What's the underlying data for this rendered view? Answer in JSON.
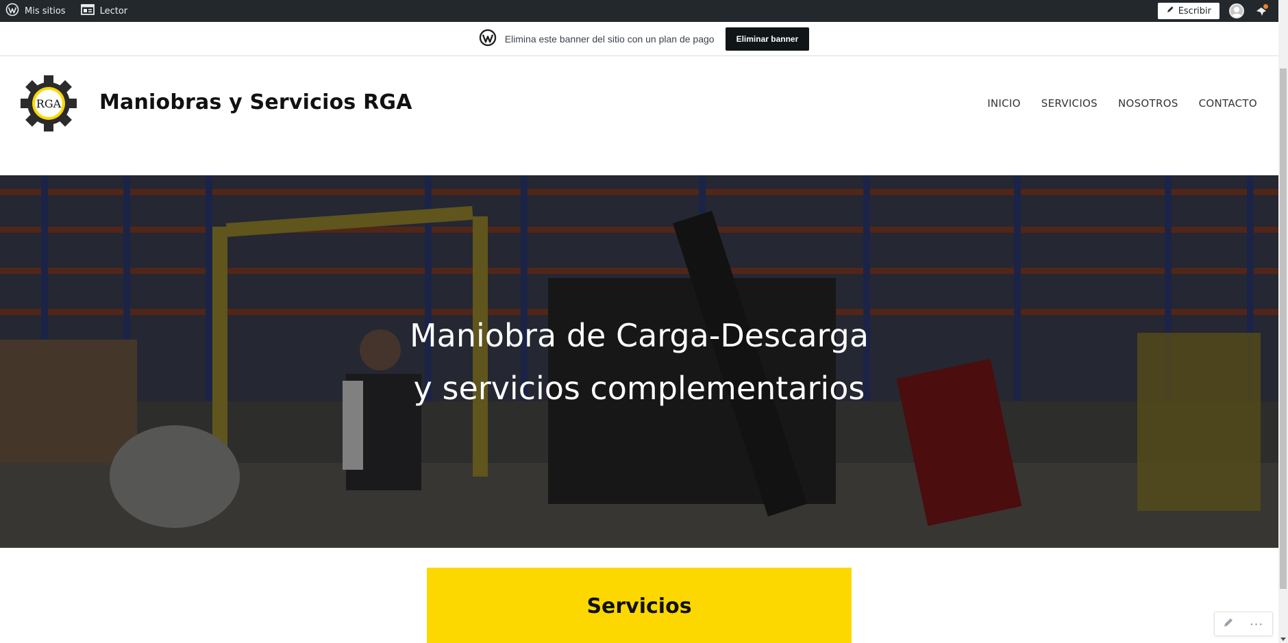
{
  "adminbar": {
    "my_sites_label": "Mis sitios",
    "reader_label": "Lector",
    "write_label": "Escribir"
  },
  "banner": {
    "text": "Elimina este banner del sitio con un plan de pago",
    "button_label": "Eliminar banner"
  },
  "header": {
    "logo_text": "RGA",
    "site_title": "Maniobras y Servicios RGA",
    "nav": [
      "INICIO",
      "SERVICIOS",
      "NOSOTROS",
      "CONTACTO"
    ]
  },
  "hero": {
    "line1": "Maniobra de Carga-Descarga",
    "line2": "y servicios complementarios"
  },
  "services": {
    "heading": "Servicios"
  },
  "colors": {
    "adminbar": "#23282d",
    "accent_yellow": "#fcd800",
    "banner_button": "#101517",
    "notification": "#f0821e"
  },
  "icons": [
    "wordpress-icon",
    "reader-icon",
    "pencil-icon",
    "avatar-icon",
    "bell-icon",
    "edit-icon",
    "more-icon"
  ]
}
